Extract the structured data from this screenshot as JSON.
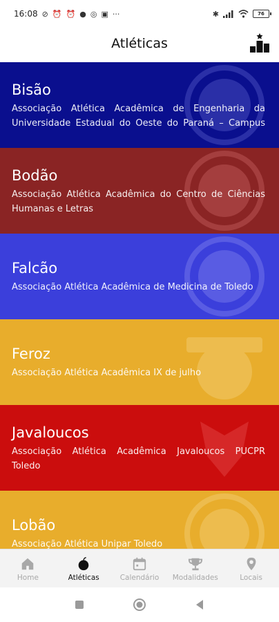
{
  "status_bar": {
    "time": "16:08",
    "icons_left": [
      "no-signal-icon",
      "alarm-icon",
      "alarm-icon",
      "chat-icon",
      "whatsapp-icon",
      "game-icon",
      "more-icon"
    ],
    "icons_right": [
      "bluetooth-icon",
      "signal-icon",
      "wifi-icon"
    ],
    "battery": "76"
  },
  "header": {
    "title": "Atléticas"
  },
  "athletics": [
    {
      "name": "Bisão",
      "description": "Associação Atlética Acadêmica de Engenharia da Universidade Estadual do Oeste do Paraná – Campus Toledo",
      "color": "#0a0f8e"
    },
    {
      "name": "Bodão",
      "description": "Associação Atlética Acadêmica do Centro de Ciências Humanas e Letras",
      "color": "#8a2424"
    },
    {
      "name": "Falcão",
      "description": "Associação Atlética Acadêmica de Medicina de Toledo",
      "color": "#3b3fdb"
    },
    {
      "name": "Feroz",
      "description": "Associação Atlética Acadêmica IX de julho",
      "color": "#e8ad2c"
    },
    {
      "name": "Javaloucos",
      "description": "Associação Atlética Acadêmica Javaloucos PUCPR Toledo",
      "color": "#cb0d0d"
    },
    {
      "name": "Lobão",
      "description": "Associação Atlética Unipar Toledo",
      "color": "#e8ad2c"
    }
  ],
  "bottom_nav": [
    {
      "label": "Home",
      "icon": "home-icon",
      "active": false
    },
    {
      "label": "Atléticas",
      "icon": "bomb-icon",
      "active": true
    },
    {
      "label": "Calendário",
      "icon": "calendar-icon",
      "active": false
    },
    {
      "label": "Modalidades",
      "icon": "trophy-icon",
      "active": false
    },
    {
      "label": "Locais",
      "icon": "location-pin-icon",
      "active": false
    }
  ]
}
